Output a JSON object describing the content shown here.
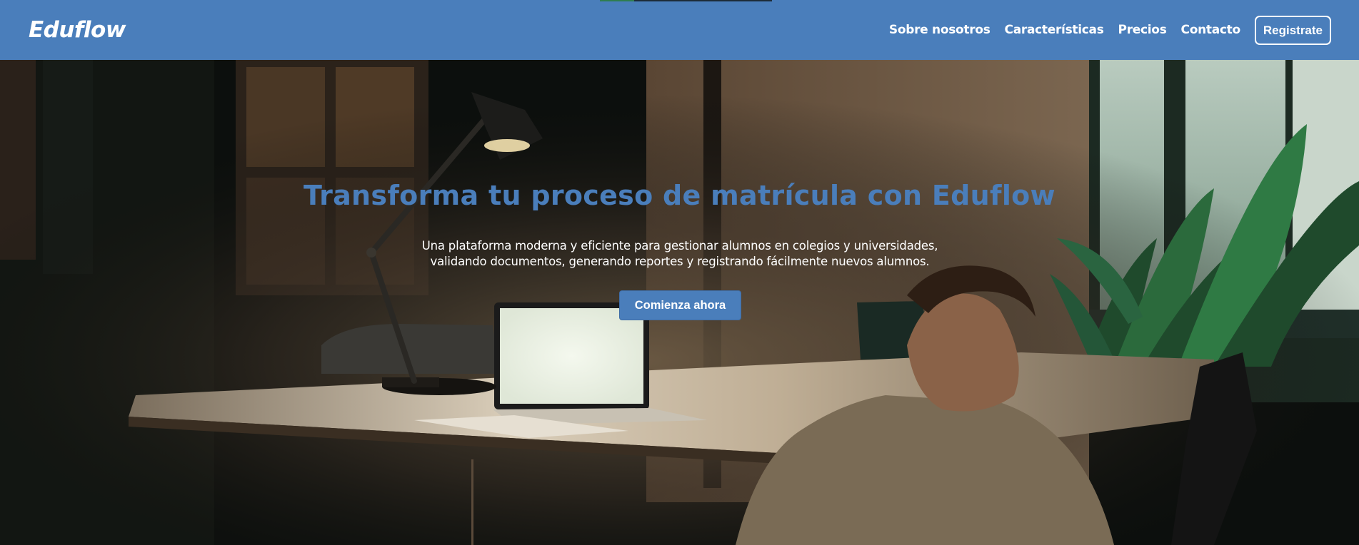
{
  "header": {
    "logo": "Eduflow",
    "nav": [
      {
        "label": "Sobre nosotros"
      },
      {
        "label": "Características"
      },
      {
        "label": "Precios"
      },
      {
        "label": "Contacto"
      }
    ],
    "register_label": "Registrate"
  },
  "hero": {
    "title": "Transforma tu proceso de matrícula con Eduflow",
    "subtitle": "Una plataforma moderna y eficiente para gestionar alumnos en colegios y universidades, validando documentos, generando reportes y registrando fácilmente nuevos alumnos.",
    "cta_label": "Comienza ahora",
    "background_image": "man-working-on-laptop-at-night-desk-lamp"
  },
  "colors": {
    "brand": "#4a7ebb",
    "text_light": "#ffffff"
  }
}
